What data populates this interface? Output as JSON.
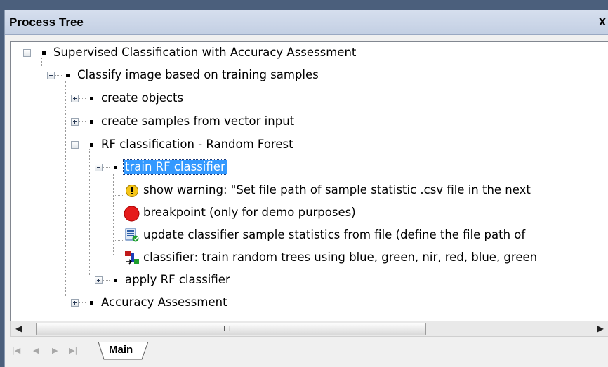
{
  "panel": {
    "title": "Process Tree",
    "close_glyph": "x"
  },
  "tree": {
    "n0": "Supervised Classification with Accuracy Assessment",
    "n1": "Classify image based on training samples",
    "n2": "create objects",
    "n3": "create samples from vector input",
    "n4": "RF classification - Random Forest",
    "n5": "train RF classifier",
    "n6": "show warning: \"Set file path of sample statistic .csv file in the next",
    "n7": "breakpoint   (only for demo purposes)",
    "n8": "update classifier sample statistics from file   (define the file path of",
    "n9": "classifier: train random trees using blue, green, nir, red, blue, green",
    "n10": "apply RF classifier",
    "n11": "Accuracy Assessment"
  },
  "icons": {
    "n6": "warning-icon",
    "n7": "breakpoint-icon",
    "n8": "update-statistics-icon",
    "n9": "classifier-icon"
  },
  "scrollbar": {
    "grip": "III"
  },
  "tabs": {
    "main_label": "Main"
  },
  "colors": {
    "selection": "#3399ff",
    "breakpoint": "#e51b1b",
    "warning": "#f5c518"
  }
}
